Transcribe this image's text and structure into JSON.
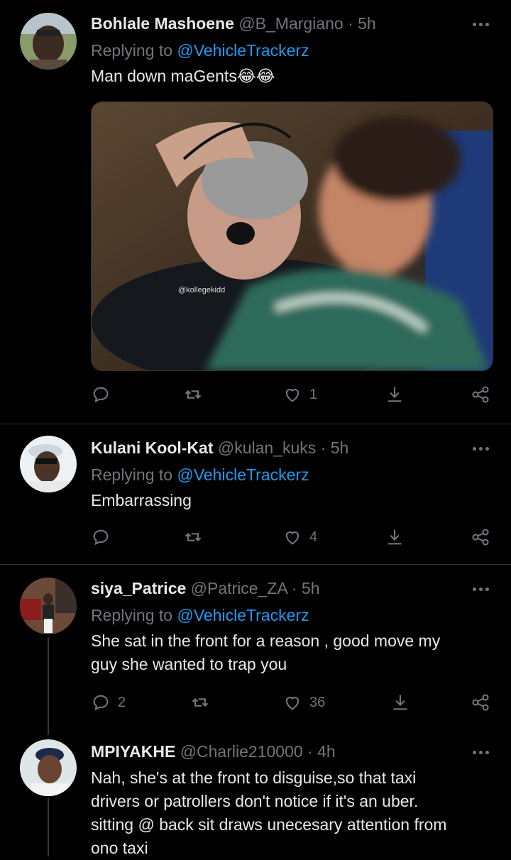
{
  "tweets": [
    {
      "name": "Bohlale Mashoene",
      "handle": "@B_Margiano",
      "time": "· 5h",
      "replying_prefix": "Replying to ",
      "replying_to": "@VehicleTrackerz",
      "text": "Man down maGents😂😂",
      "media_watermark": "@kollegekidd",
      "replies": "",
      "likes": "1"
    },
    {
      "name": "Kulani Kool-Kat",
      "handle": "@kulan_kuks",
      "time": "· 5h",
      "replying_prefix": "Replying to ",
      "replying_to": "@VehicleTrackerz",
      "text": "Embarrassing",
      "replies": "",
      "likes": "4"
    },
    {
      "name": "siya_Patrice",
      "handle": "@Patrice_ZA",
      "time": "· 5h",
      "replying_prefix": "Replying to ",
      "replying_to": "@VehicleTrackerz",
      "text_lines": [
        "She sat in the front for a reason , good move my",
        "guy she wanted to trap you"
      ],
      "replies": "2",
      "likes": "36"
    },
    {
      "name": "MPIYAKHE",
      "handle": "@Charlie210000",
      "time": "· 4h",
      "text_lines": [
        "Nah, she's at the front to disguise,so that taxi",
        "drivers or patrollers don't notice if it's an uber.",
        "sitting @ back sit draws unecesary attention from",
        "ono taxi"
      ]
    }
  ],
  "icons": {
    "reply": "reply-icon",
    "retweet": "retweet-icon",
    "like": "heart-icon",
    "share": "share-icon",
    "more": "more-icon",
    "download": "download-icon"
  },
  "colors": {
    "background": "#000000",
    "text": "#e7e9ea",
    "muted": "#71767b",
    "link": "#1d9bf0"
  }
}
